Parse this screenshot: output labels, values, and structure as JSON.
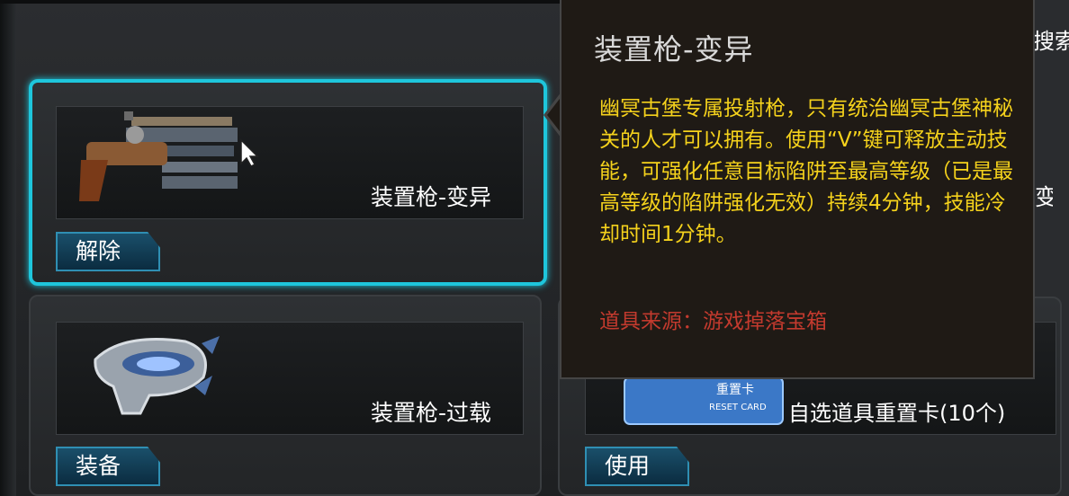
{
  "inventory": {
    "items": [
      {
        "name": "装置枪-变异",
        "button": "解除",
        "selected": true
      },
      {
        "name": "装置枪-过载",
        "button": "装备",
        "selected": false
      },
      {
        "name": "自选道具重置卡(10个)",
        "button": "使用",
        "selected": false,
        "card_text": "RESET CARD",
        "card_title": "重置卡"
      }
    ],
    "search_label": "搜索",
    "partial_item_char": "变"
  },
  "tooltip": {
    "title": "装置枪-变异",
    "description": "幽冥古堡专属投射枪，只有统治幽冥古堡神秘关的人才可以拥有。使用“V”键可释放主动技能，可强化任意目标陷阱至最高等级（已是最高等级的陷阱强化无效）持续4分钟，技能冷却时间1分钟。",
    "source": "道具来源：游戏掉落宝箱"
  },
  "colors": {
    "selected_border": "#1ec6dc",
    "description_text": "#f5d21c",
    "source_text": "#c33a2e",
    "button_fill": "#0b2c40"
  },
  "icons": [
    "gun-mutation-icon",
    "gun-overload-icon",
    "reset-card-icon",
    "mouse-cursor-icon"
  ]
}
